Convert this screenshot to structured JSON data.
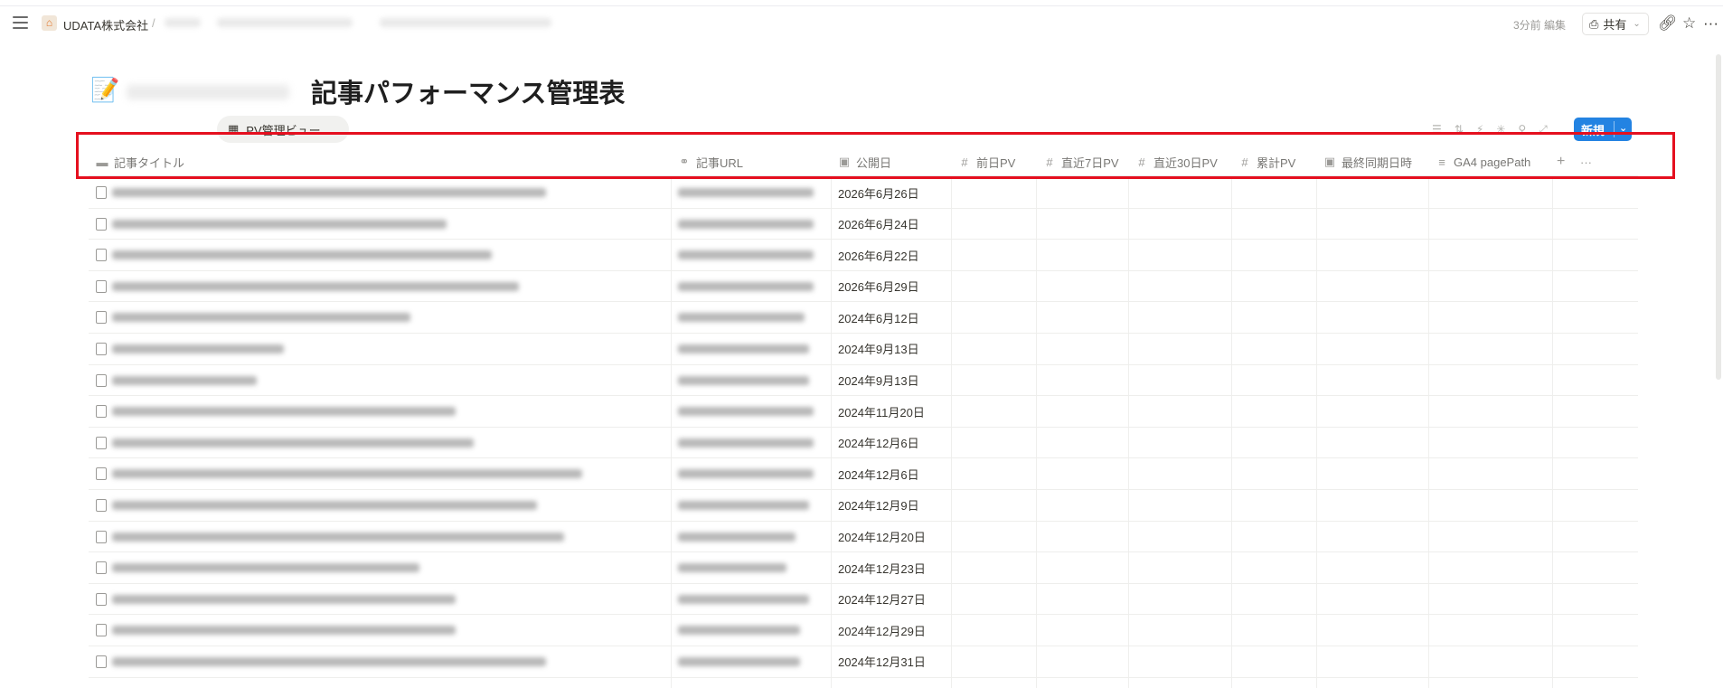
{
  "breadcrumb": {
    "workspace": "UDATA株式会社",
    "separator": "/"
  },
  "topbar": {
    "edited": "3分前 編集",
    "share_label": "共有"
  },
  "page": {
    "icon": "memo-emoji",
    "title": "記事パフォーマンス管理表"
  },
  "view": {
    "tab_label": "PV管理ビュー"
  },
  "actions": {
    "new_label": "新規"
  },
  "table": {
    "columns": [
      {
        "label": "記事タイトル",
        "icon": "title-icon"
      },
      {
        "label": "記事URL",
        "icon": "link-icon"
      },
      {
        "label": "公開日",
        "icon": "calendar-icon"
      },
      {
        "label": "前日PV",
        "icon": "number-icon"
      },
      {
        "label": "直近7日PV",
        "icon": "number-icon"
      },
      {
        "label": "直近30日PV",
        "icon": "number-icon"
      },
      {
        "label": "累計PV",
        "icon": "number-icon"
      },
      {
        "label": "最終同期日時",
        "icon": "calendar-icon"
      },
      {
        "label": "GA4 pagePath",
        "icon": "text-icon"
      }
    ],
    "add_column": "+",
    "more": "···",
    "rows": [
      {
        "date": "2026年6月26日"
      },
      {
        "date": "2026年6月24日"
      },
      {
        "date": "2026年6月22日"
      },
      {
        "date": "2026年6月29日"
      },
      {
        "date": "2024年6月12日"
      },
      {
        "date": "2024年9月13日"
      },
      {
        "date": "2024年9月13日"
      },
      {
        "date": "2024年11月20日"
      },
      {
        "date": "2024年12月6日"
      },
      {
        "date": "2024年12月6日"
      },
      {
        "date": "2024年12月9日"
      },
      {
        "date": "2024年12月20日"
      },
      {
        "date": "2024年12月23日"
      },
      {
        "date": "2024年12月27日"
      },
      {
        "date": "2024年12月29日"
      },
      {
        "date": "2024年12月31日"
      }
    ]
  },
  "colors": {
    "accent": "#2383e2",
    "highlight": "#e5101f",
    "text": "#37352f",
    "muted": "#787774"
  }
}
